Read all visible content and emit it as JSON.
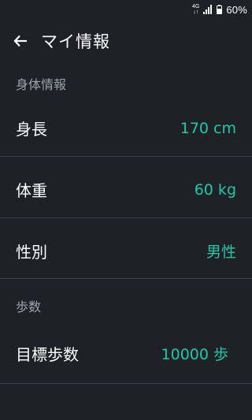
{
  "status_bar": {
    "network_top": "4G",
    "network_bottom": "↓↑",
    "battery": "60%",
    "icons": [
      "signal-icon",
      "battery-icon"
    ]
  },
  "app_bar": {
    "title": "マイ情報",
    "back_icon": "back-arrow-icon"
  },
  "sections": [
    {
      "header": "身体情報",
      "rows": [
        {
          "label": "身長",
          "value": "170 cm"
        },
        {
          "label": "体重",
          "value": "60 kg"
        },
        {
          "label": "性別",
          "value": "男性"
        }
      ]
    },
    {
      "header": "歩数",
      "rows": [
        {
          "label": "目標歩数",
          "value": "10000 歩"
        }
      ]
    }
  ],
  "colors": {
    "background": "#1e2126",
    "accent": "#22c7a9",
    "section_header": "#9ea3aa",
    "divider": "#3a3e44"
  }
}
